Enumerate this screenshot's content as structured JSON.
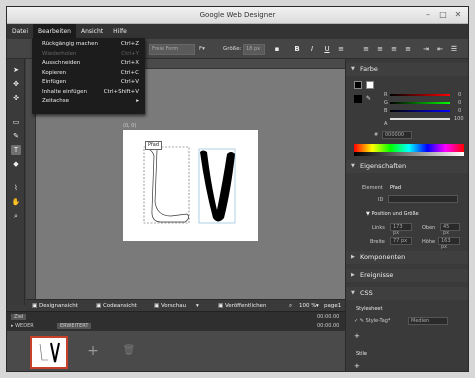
{
  "window": {
    "title": "Google Web Designer"
  },
  "menubar": [
    "Datei",
    "Bearbeiten",
    "Ansicht",
    "Hilfe"
  ],
  "edit_menu": [
    {
      "label": "Rückgängig machen",
      "shortcut": "Ctrl+Z",
      "disabled": false
    },
    {
      "label": "Wiederholen",
      "shortcut": "Ctrl+Y",
      "disabled": true
    },
    {
      "label": "Ausschneiden",
      "shortcut": "Ctrl+X",
      "disabled": false
    },
    {
      "label": "Kopieren",
      "shortcut": "Ctrl+C",
      "disabled": false
    },
    {
      "label": "Einfügen",
      "shortcut": "Ctrl+V",
      "disabled": false
    },
    {
      "label": "Inhalte einfügen",
      "shortcut": "Ctrl+Shift+V",
      "disabled": false
    },
    {
      "label": "Zeitachse",
      "shortcut": "▸",
      "disabled": false
    }
  ],
  "toolbar": {
    "font_field": "Freie Form",
    "font_label": "F▾",
    "size_label": "Größe:",
    "size_value": "18 px"
  },
  "stage": {
    "coord": "(0, 0)",
    "tag": "Pfad"
  },
  "bottombar": {
    "design": "Designansicht",
    "code": "Codeansicht",
    "preview": "Vorschau",
    "publish": "Veröffentlichen",
    "zoom": "100",
    "zoom_unit": "%",
    "page": "page1"
  },
  "timeline": {
    "mode": "WEDER",
    "mode2": "ERWEITERT",
    "tab": "Ziel",
    "time": "00:00.00",
    "time2": "00:00.00"
  },
  "color_panel": {
    "title": "Farbe",
    "r_label": "R",
    "g_label": "G",
    "b_label": "B",
    "a_label": "A",
    "r": "0",
    "g": "0",
    "b": "0",
    "a": "100",
    "hex_label": "#",
    "hex": "000000"
  },
  "properties": {
    "title": "Eigenschaften",
    "element_label": "Element",
    "element_value": "Pfad",
    "id_label": "ID",
    "pos_title": "Position und Größe",
    "links_label": "Links",
    "links_value": "173 px",
    "oben_label": "Oben",
    "oben_value": "45 px",
    "breite_label": "Breite",
    "breite_value": "77 px",
    "hoehe_label": "Höhe",
    "hoehe_value": "163 px"
  },
  "sections": {
    "komponenten": "Komponenten",
    "ereignisse": "Ereignisse",
    "css": "CSS",
    "stylesheet": "Stylesheet",
    "style_tag": "Style-Tag*",
    "style_field": "Medien",
    "styles": "Stile"
  }
}
